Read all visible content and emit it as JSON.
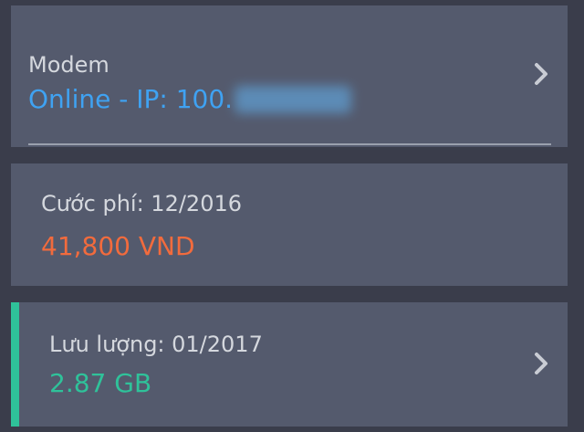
{
  "colors": {
    "background": "#3a3d4b",
    "card": "#545a6d",
    "label": "#d5d8de",
    "modem_status": "#3fa2f2",
    "fee": "#f26b3d",
    "usage": "#2fc29a"
  },
  "modem": {
    "label": "Modem",
    "status": "Online - IP: 100.",
    "icon": "chevron-right-icon"
  },
  "fee": {
    "label": "Cước phí: 12/2016",
    "amount": "41,800 VND"
  },
  "usage": {
    "label": "Lưu lượng: 01/2017",
    "amount": "2.87 GB",
    "icon": "chevron-right-icon"
  }
}
